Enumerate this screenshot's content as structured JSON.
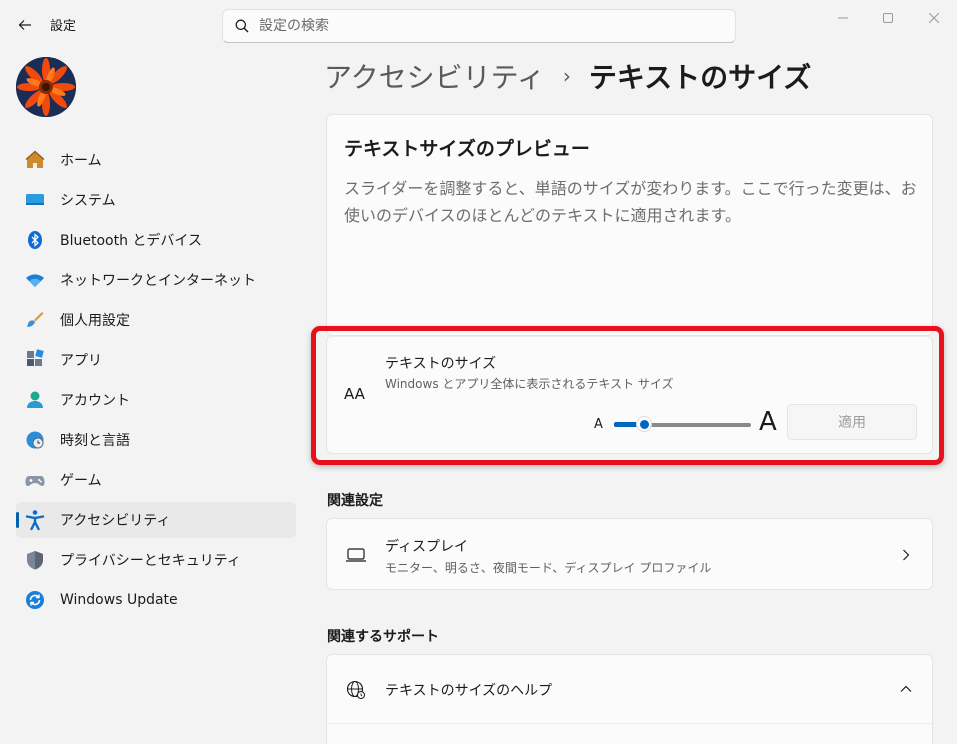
{
  "titlebar": {
    "app_title": "設定",
    "search_placeholder": "設定の検索"
  },
  "sidebar": {
    "items": [
      {
        "label": "ホーム",
        "icon": "home-icon"
      },
      {
        "label": "システム",
        "icon": "monitor-icon"
      },
      {
        "label": "Bluetooth とデバイス",
        "icon": "bluetooth-icon"
      },
      {
        "label": "ネットワークとインターネット",
        "icon": "wifi-icon"
      },
      {
        "label": "個人用設定",
        "icon": "brush-icon"
      },
      {
        "label": "アプリ",
        "icon": "apps-icon"
      },
      {
        "label": "アカウント",
        "icon": "account-icon"
      },
      {
        "label": "時刻と言語",
        "icon": "clock-globe-icon"
      },
      {
        "label": "ゲーム",
        "icon": "gamepad-icon"
      },
      {
        "label": "アクセシビリティ",
        "icon": "accessibility-icon",
        "active": true
      },
      {
        "label": "プライバシーとセキュリティ",
        "icon": "shield-icon"
      },
      {
        "label": "Windows Update",
        "icon": "update-icon"
      }
    ]
  },
  "breadcrumb": {
    "parent": "アクセシビリティ",
    "separator": "›",
    "current": "テキストのサイズ"
  },
  "preview": {
    "title": "テキストサイズのプレビュー",
    "description": "スライダーを調整すると、単語のサイズが変わります。ここで行った変更は、お使いのデバイスのほとんどのテキストに適用されます。"
  },
  "text_size": {
    "icon_glyph": "AA",
    "title": "テキストのサイズ",
    "subtitle": "Windows とアプリ全体に表示されるテキスト サイズ",
    "small_a": "A",
    "big_a": "A",
    "apply_label": "適用",
    "slider_value_fraction": 0.22
  },
  "related_settings": {
    "heading": "関連設定",
    "display": {
      "title": "ディスプレイ",
      "subtitle": "モニター、明るさ、夜間モード、ディスプレイ プロファイル"
    }
  },
  "related_support": {
    "heading": "関連するサポート",
    "help": {
      "title": "テキストのサイズのヘルプ"
    }
  },
  "colors": {
    "accent": "#0067c0",
    "highlight": "#e8101a"
  }
}
